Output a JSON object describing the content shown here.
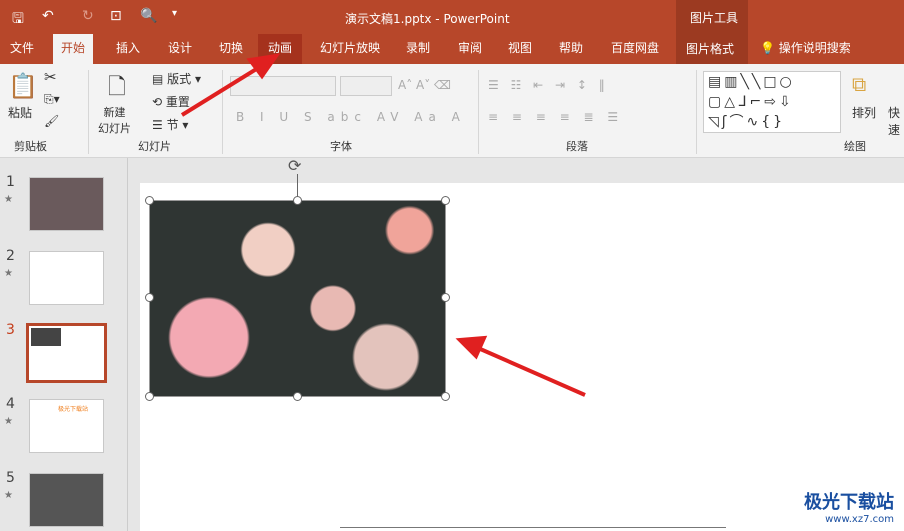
{
  "titlebar": {
    "title": "演示文稿1.pptx  -  PowerPoint",
    "tool_tab": "图片工具",
    "qa_icons": [
      "save-icon",
      "undo-icon",
      "redo-icon",
      "present-icon",
      "print-preview-icon",
      "customize-icon"
    ]
  },
  "tabs": [
    "文件",
    "开始",
    "插入",
    "设计",
    "切换",
    "动画",
    "幻灯片放映",
    "录制",
    "审阅",
    "视图",
    "帮助",
    "百度网盘",
    "图片格式"
  ],
  "search": "操作说明搜索",
  "ribbon": {
    "clipboard": {
      "paste": "粘贴",
      "label": "剪贴板"
    },
    "slides": {
      "new_slide": "新建\n幻灯片",
      "layout": "版式",
      "reset": "重置",
      "section": "节",
      "label": "幻灯片"
    },
    "font": {
      "label": "字体"
    },
    "paragraph": {
      "label": "段落"
    },
    "drawing": {
      "arrange": "排列",
      "quick": "快速",
      "label": "绘图"
    }
  },
  "slides": [
    {
      "num": "1"
    },
    {
      "num": "2"
    },
    {
      "num": "3",
      "selected": true
    },
    {
      "num": "4",
      "title": "极光下载站"
    },
    {
      "num": "5"
    }
  ],
  "watermark": {
    "name": "极光下载站",
    "url": "www.xz7.com"
  },
  "colors": {
    "accent": "#b7472a",
    "arrow": "#e02020"
  }
}
